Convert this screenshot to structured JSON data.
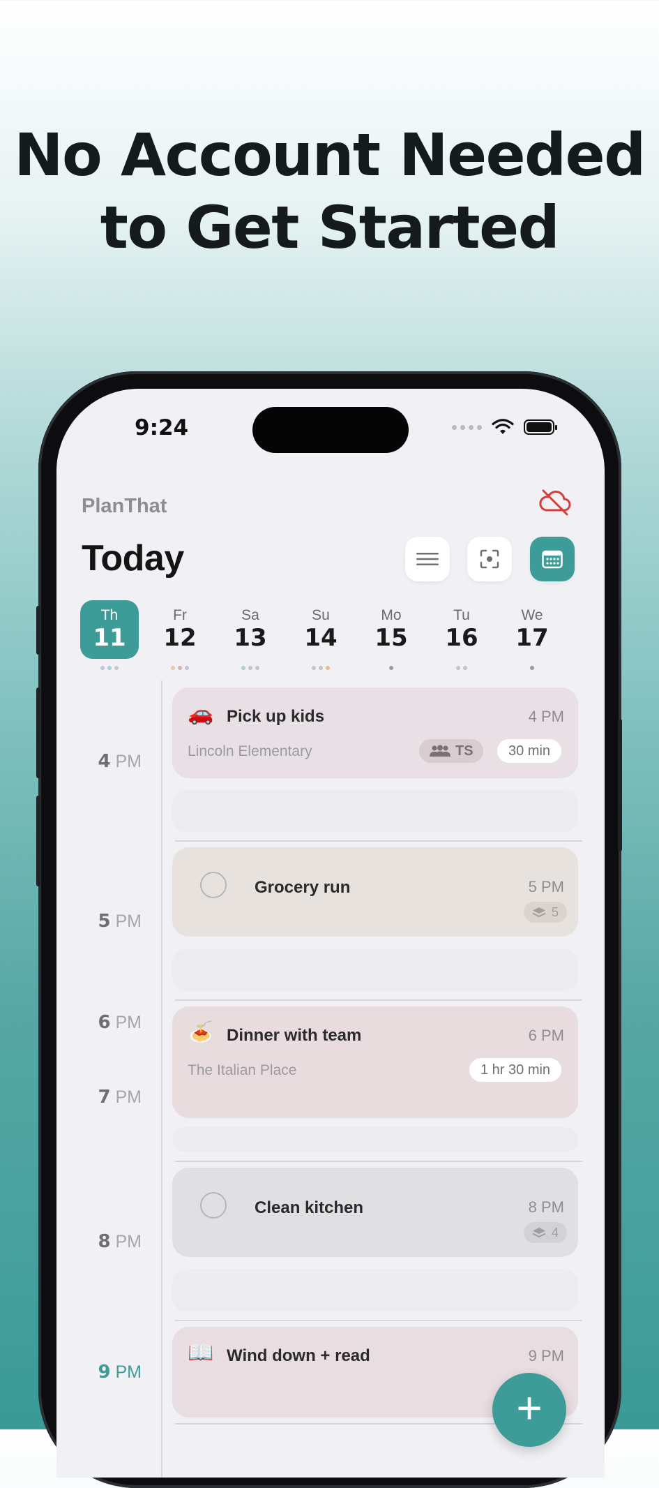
{
  "headline": {
    "line1": "No Account Needed",
    "line2": "to Get Started"
  },
  "status_bar": {
    "time": "9:24"
  },
  "app": {
    "name": "PlanThat",
    "title": "Today"
  },
  "week": [
    {
      "dn": "Th",
      "dd": "11",
      "selected": true
    },
    {
      "dn": "Fr",
      "dd": "12"
    },
    {
      "dn": "Sa",
      "dd": "13"
    },
    {
      "dn": "Su",
      "dd": "14"
    },
    {
      "dn": "Mo",
      "dd": "15"
    },
    {
      "dn": "Tu",
      "dd": "16"
    },
    {
      "dn": "We",
      "dd": "17"
    }
  ],
  "hours": {
    "h4": {
      "num": "4",
      "ampm": "PM"
    },
    "h5": {
      "num": "5",
      "ampm": "PM"
    },
    "h6": {
      "num": "6",
      "ampm": "PM"
    },
    "h7": {
      "num": "7",
      "ampm": "PM"
    },
    "h8": {
      "num": "8",
      "ampm": "PM"
    },
    "h9": {
      "num": "9",
      "ampm": "PM"
    }
  },
  "events": {
    "pickup": {
      "emoji": "🚗",
      "title": "Pick up kids",
      "time": "4 PM",
      "location": "Lincoln Elementary",
      "attendee": "TS",
      "duration": "30 min"
    },
    "grocery": {
      "title": "Grocery run",
      "time": "5 PM",
      "subtasks": "5"
    },
    "dinner": {
      "emoji": "🍝",
      "title": "Dinner with team",
      "time": "6 PM",
      "location": "The Italian Place",
      "duration": "1 hr 30 min"
    },
    "kitchen": {
      "title": "Clean kitchen",
      "time": "8 PM",
      "subtasks": "4"
    },
    "winddown": {
      "emoji": "📖",
      "title": "Wind down + read",
      "time": "9 PM"
    }
  },
  "colors": {
    "accent": "#3e9c98",
    "sync_off": "#d93b3b"
  },
  "fab": {
    "label": "+"
  }
}
